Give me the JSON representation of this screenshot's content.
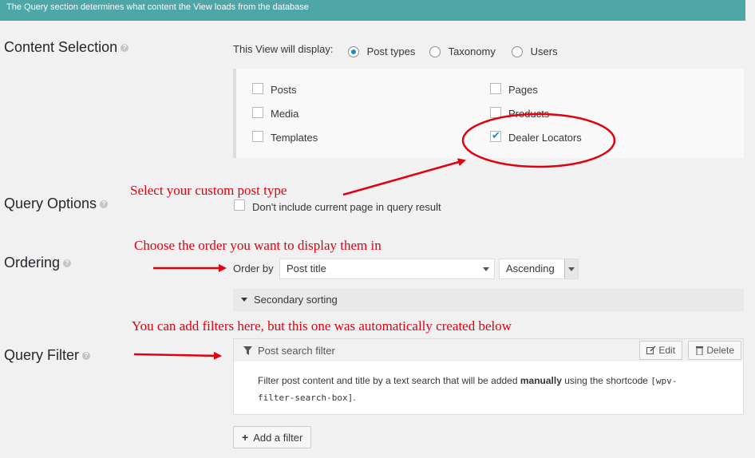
{
  "banner": "The Query section determines what content the View loads from the database",
  "content_selection": {
    "title": "Content Selection",
    "display_label": "This View will display:",
    "radios": [
      {
        "label": "Post types",
        "checked": true
      },
      {
        "label": "Taxonomy",
        "checked": false
      },
      {
        "label": "Users",
        "checked": false
      }
    ],
    "post_types": [
      {
        "label": "Posts",
        "checked": false
      },
      {
        "label": "Media",
        "checked": false
      },
      {
        "label": "Templates",
        "checked": false
      },
      {
        "label": "Pages",
        "checked": false
      },
      {
        "label": "Products",
        "checked": false
      },
      {
        "label": "Dealer Locators",
        "checked": true
      }
    ]
  },
  "annotations": {
    "custom_post_type": "Select your custom post type",
    "order": "Choose the order you want to display them in",
    "filters": "You can add filters here, but this one was automatically created below"
  },
  "query_options": {
    "title": "Query Options",
    "exclude_current_label": "Don't include current page in query result",
    "exclude_current_checked": false
  },
  "ordering": {
    "title": "Ordering",
    "order_by_label": "Order by",
    "order_by_value": "Post title",
    "direction_value": "Ascending",
    "secondary_label": "Secondary sorting"
  },
  "query_filter": {
    "title": "Query Filter",
    "filter_name": "Post search filter",
    "edit_label": "Edit",
    "delete_label": "Delete",
    "desc_prefix": "Filter post content and title by a text search that will be added ",
    "desc_bold": "manually",
    "desc_mid": " using the shortcode ",
    "shortcode_line1": "[wpv-",
    "shortcode_line2": "filter-search-box]",
    "desc_suffix": ".",
    "add_filter_label": "Add a filter"
  },
  "help_icon": "?",
  "colors": {
    "banner": "#4ea6a6",
    "annotation": "#e2000f",
    "checkbox_accent": "#1e8cbe"
  }
}
